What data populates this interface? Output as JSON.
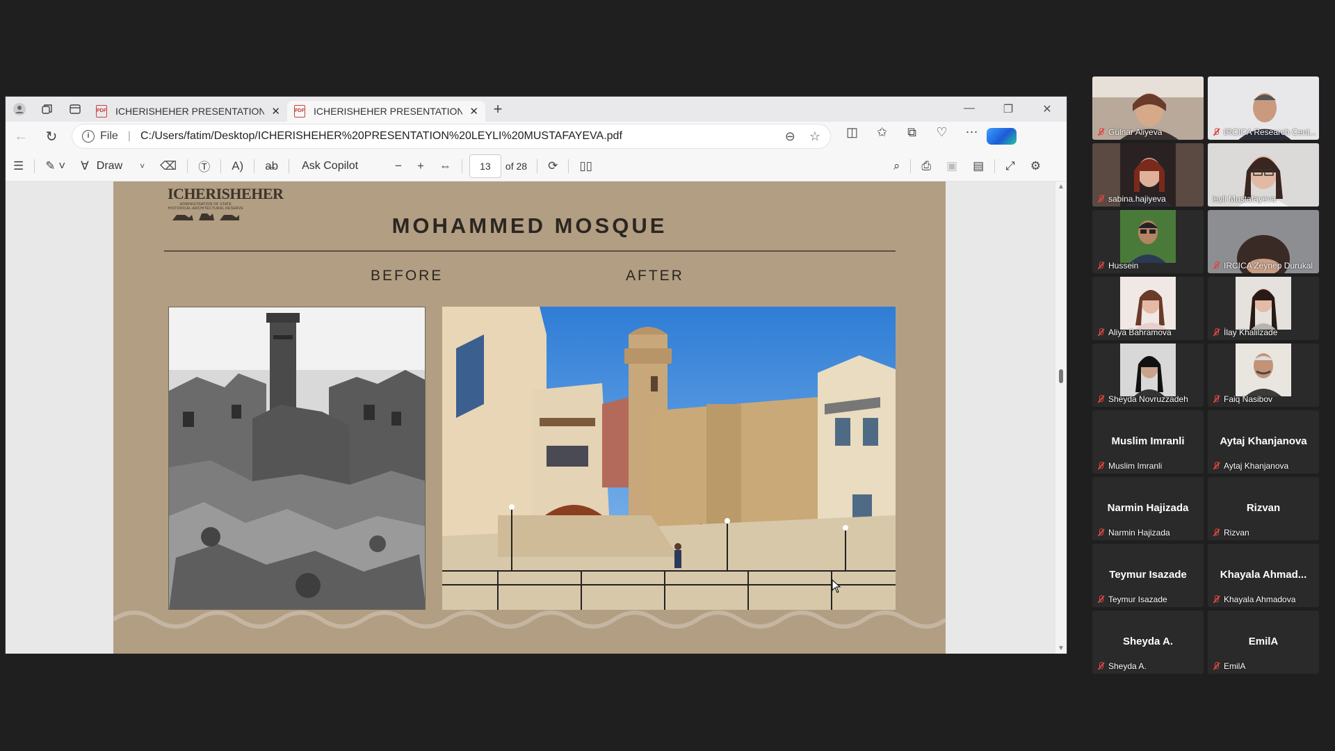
{
  "browser": {
    "tabs": [
      {
        "title": "ICHERISHEHER PRESENTATION L",
        "active": false
      },
      {
        "title": "ICHERISHEHER PRESENTATION L",
        "active": true
      }
    ],
    "address": {
      "scheme_label": "File",
      "url": "C:/Users/fatim/Desktop/ICHERISHEHER%20PRESENTATION%20LEYLI%20MUSTAFAYEVA.pdf"
    }
  },
  "pdf_toolbar": {
    "draw_label": "Draw",
    "copilot_label": "Ask Copilot",
    "page_current": "13",
    "page_total_label": "of 28"
  },
  "slide": {
    "logo_text": "ICHERISHEHER",
    "logo_subtext": "ADMINISTRATION OF STATE HISTORICAL-ARCHITECTURAL RESERVE",
    "title": "MOHAMMED MOSQUE",
    "before_label": "BEFORE",
    "after_label": "AFTER"
  },
  "participants": [
    {
      "name": "Gülnar Aliyeva",
      "video": true,
      "speaking": false
    },
    {
      "name": "IRCICA Research Cent...",
      "video": true,
      "speaking": false
    },
    {
      "name": "sabina.hajiyeva",
      "video": true,
      "speaking": false
    },
    {
      "name": "leyli Mustafayeva",
      "video": true,
      "speaking": true
    },
    {
      "name": "Hussein",
      "video": true,
      "speaking": false
    },
    {
      "name": "IRCICA Zeynep Durukal",
      "video": true,
      "speaking": false
    },
    {
      "name": "Aliya Bahramova",
      "video": true,
      "speaking": false
    },
    {
      "name": "İlay Khalilzade",
      "video": true,
      "speaking": false
    },
    {
      "name": "Sheyda Novruzzadeh",
      "video": true,
      "speaking": false
    },
    {
      "name": "Faiq Nasibov",
      "video": true,
      "speaking": false
    },
    {
      "name": "Muslim Imranli",
      "display": "Muslim Imranli",
      "video": false
    },
    {
      "name": "Aytaj Khanjanova",
      "display": "Aytaj Khanjanova",
      "video": false
    },
    {
      "name": "Narmin Hajizada",
      "display": "Narmin Hajizada",
      "video": false
    },
    {
      "name": "Rizvan",
      "display": "Rizvan",
      "video": false
    },
    {
      "name": "Teymur Isazade",
      "display": "Teymur Isazade",
      "video": false
    },
    {
      "name": "Khayala Ahmadova",
      "display": "Khayala  Ahmad...",
      "video": false
    },
    {
      "name": "Sheyda A.",
      "display": "Sheyda A.",
      "video": false
    },
    {
      "name": "EmilA",
      "display": "EmilA",
      "video": false
    }
  ]
}
